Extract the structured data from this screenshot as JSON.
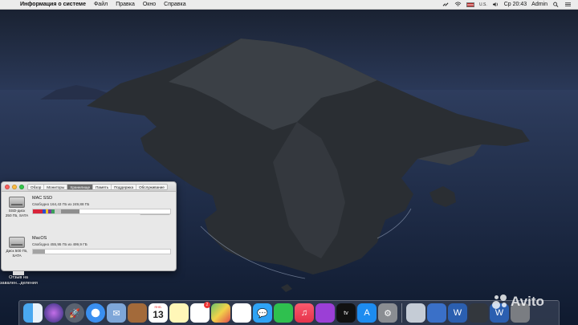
{
  "menubar": {
    "app_name": "Информация о системе",
    "menus": [
      "Файл",
      "Правка",
      "Окно",
      "Справка"
    ],
    "status": {
      "input_language": "U.S.",
      "clock": "Ср 20:43",
      "user": "Admin"
    }
  },
  "window": {
    "tabs": [
      "Обзор",
      "Мониторы",
      "Хранилище",
      "Память",
      "Поддержка",
      "Обслуживание"
    ],
    "active_tab": "Хранилище",
    "disks": [
      {
        "name": "MAC SSD",
        "free_text": "Свободно 164,43 ГБ из 249,88 ГБ",
        "caption_line1": "SSD-диск",
        "caption_line2": "250 ГБ, SATA",
        "usage_fraction": 0.34,
        "manage_label": "Управлять..."
      },
      {
        "name": "MacOS",
        "free_text": "Свободно 455,95 ГБ из 499,9 ГБ",
        "caption_line1": "Диск 500 ГБ,",
        "caption_line2": "SATA",
        "usage_fraction": 0.09
      }
    ]
  },
  "desktop_icon": {
    "label_line1": "Отзыв на",
    "label_line2": "завален...деления"
  },
  "dock": {
    "calendar": {
      "month": "ЯНВ.",
      "day": "13"
    },
    "reminders_badge": "2"
  },
  "watermark": "Avito",
  "colors": {
    "accent_active_tab": "#6c6c6c",
    "usage_segments": [
      "#d8243a",
      "#2a4fd0",
      "#f0c020",
      "#7a3aa0",
      "#3aa05a",
      "#c9c9c9",
      "#8e8e8e"
    ]
  }
}
